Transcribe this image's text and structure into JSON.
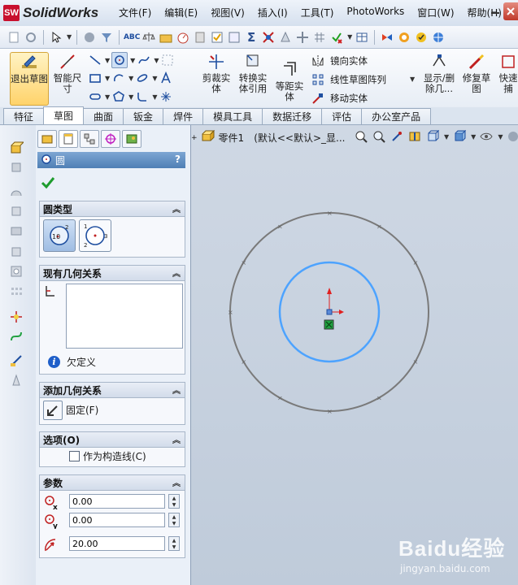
{
  "app": {
    "brand": "SolidWorks",
    "logo_badge": "SW",
    "menus": [
      "文件(F)",
      "编辑(E)",
      "视图(V)",
      "插入(I)",
      "工具(T)",
      "PhotoWorks",
      "窗口(W)",
      "帮助(H)"
    ]
  },
  "command_manager": {
    "exit_sketch": "退出草图",
    "smart_dimension": "智能尺寸",
    "trim": "剪裁实体",
    "convert": "转换实体引用",
    "offset": "等距实体",
    "mirror": "镜向实体",
    "linear_pattern": "线性草图阵列",
    "move": "移动实体",
    "show_delete": "显示/删除几...",
    "repair": "修复草图",
    "quick": "快速捕"
  },
  "tabs": [
    "特征",
    "草图",
    "曲面",
    "钣金",
    "焊件",
    "模具工具",
    "数据迁移",
    "评估",
    "办公室产品"
  ],
  "active_tab": "草图",
  "property_manager": {
    "title": "圆",
    "help": "?",
    "circle_type": {
      "label": "圆类型",
      "center_badge": "10",
      "perim_badges": [
        "1",
        "2",
        "3"
      ]
    },
    "existing_relations": {
      "label": "现有几何关系",
      "status": "欠定义"
    },
    "add_relations": {
      "label": "添加几何关系",
      "fix": "固定(F)"
    },
    "options": {
      "label": "选项(O)",
      "construction": "作为构造线(C)",
      "construction_checked": false
    },
    "params": {
      "label": "参数",
      "cx": "0.00",
      "cy": "0.00",
      "radius": "20.00"
    }
  },
  "graphics": {
    "tree_item": "零件1",
    "config": "(默认<<默认>_显..."
  },
  "colors": {
    "sketch_circle": "#4da3ff",
    "outer_circle": "#7a7a7a",
    "origin_red": "#e02020",
    "header_blue": "#4f7fb5"
  },
  "watermark": {
    "logo": "Baidu经验",
    "url": "jingyan.baidu.com"
  }
}
